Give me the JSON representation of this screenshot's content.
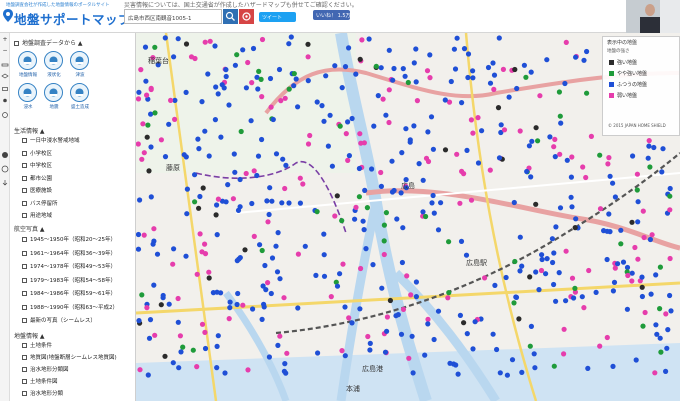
{
  "header": {
    "logo_tagline": "地盤調査会社が作成した地盤情報のポータルサイト",
    "logo_title": "地盤サポートマップ",
    "notice": "災害情報については、国土交通省が作成したハザードマップも併せてご確認ください。",
    "search_value": "広島市西区南観音1005-1",
    "tweet_label": "ツイート",
    "like_label": "いいね！ 1.5万"
  },
  "toolbar": {
    "zoom_in": "+",
    "zoom_out": "−"
  },
  "sidebar": {
    "data_section": "地盤調査データから",
    "icons": [
      {
        "label": "地盤情報",
        "icon": "landslide-icon"
      },
      {
        "label": "液状化",
        "icon": "liquefaction-icon"
      },
      {
        "label": "津波",
        "icon": "tsunami-icon"
      },
      {
        "label": "浸水",
        "icon": "flood-icon"
      },
      {
        "label": "地震",
        "icon": "earthquake-icon"
      },
      {
        "label": "盛土造成",
        "icon": "fill-icon"
      }
    ],
    "life_section": "生活情報",
    "life_items": [
      "一日中浸水警戒地域",
      "小学校区",
      "中学校区",
      "都市公園",
      "医療施設",
      "バス停留所",
      "用途地域"
    ],
    "aerial_section": "航空写真",
    "aerial_items": [
      "1945～1950年（昭和20～25年）",
      "1961～1964年（昭和36～39年）",
      "1974～1978年（昭和49～53年）",
      "1979～1983年（昭和54～58年）",
      "1984～1986年（昭和59～61年）",
      "1988～1990年（昭和63～平成2）",
      "最新の写真（シームレス）"
    ],
    "terrain_section": "地盤情報",
    "terrain_items": [
      "土地条件",
      "地質図(地盤断層シームレス地質図)",
      "治水地形分類図",
      "土地条件図",
      "治水地形分類"
    ]
  },
  "map": {
    "labels": [
      {
        "text": "稲葉台",
        "color": "#333333"
      },
      {
        "text": "藤原",
        "color": "#333333"
      },
      {
        "text": "広島",
        "color": "#333333"
      },
      {
        "text": "広島駅",
        "color": "#333333"
      },
      {
        "text": "広島港",
        "color": "#333333"
      },
      {
        "text": "本浦",
        "color": "#333333"
      }
    ]
  },
  "legend": {
    "title": "表示中の地盤",
    "subtitle": "地盤の強さ",
    "items": [
      {
        "label": "強い地盤",
        "color": "#2b2b2b"
      },
      {
        "label": "やや強い地盤",
        "color": "#1f9b3a"
      },
      {
        "label": "ふつうの地盤",
        "color": "#1f4fd6"
      },
      {
        "label": "弱い地盤",
        "color": "#e63dac"
      }
    ],
    "copyright": "© 2015 JAPAN HOME SHIELD"
  }
}
